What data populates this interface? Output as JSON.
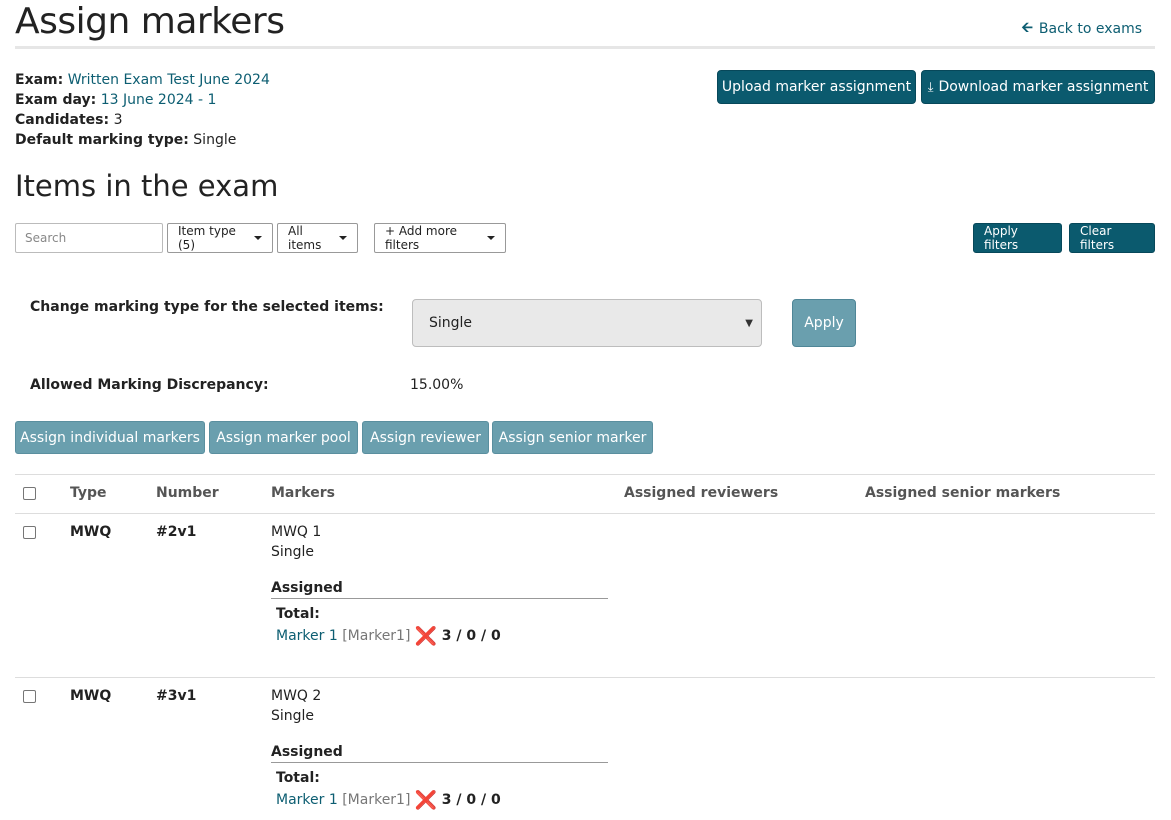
{
  "header": {
    "title": "Assign markers",
    "back_label": "Back to exams"
  },
  "meta": {
    "exam_key": "Exam:",
    "exam_val": "Written Exam Test June 2024",
    "day_key": "Exam day:",
    "day_val": "13 June 2024 - 1",
    "candidates_key": "Candidates:",
    "candidates_val": "3",
    "marking_key": "Default marking type:",
    "marking_val": "Single"
  },
  "actions": {
    "upload": "Upload marker assignment",
    "download": "Download marker assignment"
  },
  "section_title": "Items in the exam",
  "filters": {
    "search_placeholder": "Search",
    "item_type": "Item type (5)",
    "all_items": "All items",
    "add_more": "+ Add more filters",
    "apply": "Apply filters",
    "clear": "Clear filters"
  },
  "bulk": {
    "change_label": "Change marking type for the selected items:",
    "select_value": "Single",
    "apply": "Apply",
    "discrepancy_label": "Allowed Marking Discrepancy:",
    "discrepancy_value": "15.00%"
  },
  "assign_buttons": {
    "individual": "Assign individual markers",
    "pool": "Assign marker pool",
    "reviewer": "Assign reviewer",
    "senior": "Assign senior marker"
  },
  "table": {
    "headers": [
      "Type",
      "Number",
      "Markers",
      "Assigned reviewers",
      "Assigned senior markers"
    ],
    "rows": [
      {
        "type": "MWQ",
        "number": "#2v1",
        "marker_link": "MWQ 1",
        "marking": "Single",
        "assigned_label": "Assigned",
        "total_label": "Total:",
        "marker_name": "Marker 1",
        "marker_tag": "[Marker1]",
        "counts": "3 / 0 / 0"
      },
      {
        "type": "MWQ",
        "number": "#3v1",
        "marker_link": "MWQ 2",
        "marking": "Single",
        "assigned_label": "Assigned",
        "total_label": "Total:",
        "marker_name": "Marker 1",
        "marker_tag": "[Marker1]",
        "counts": "3 / 0 / 0"
      }
    ]
  },
  "colors": {
    "primary_button": "#0b5a6e",
    "muted_button": "#6a9fae",
    "link": "#0d5e72",
    "error_x": "#d6151b"
  }
}
